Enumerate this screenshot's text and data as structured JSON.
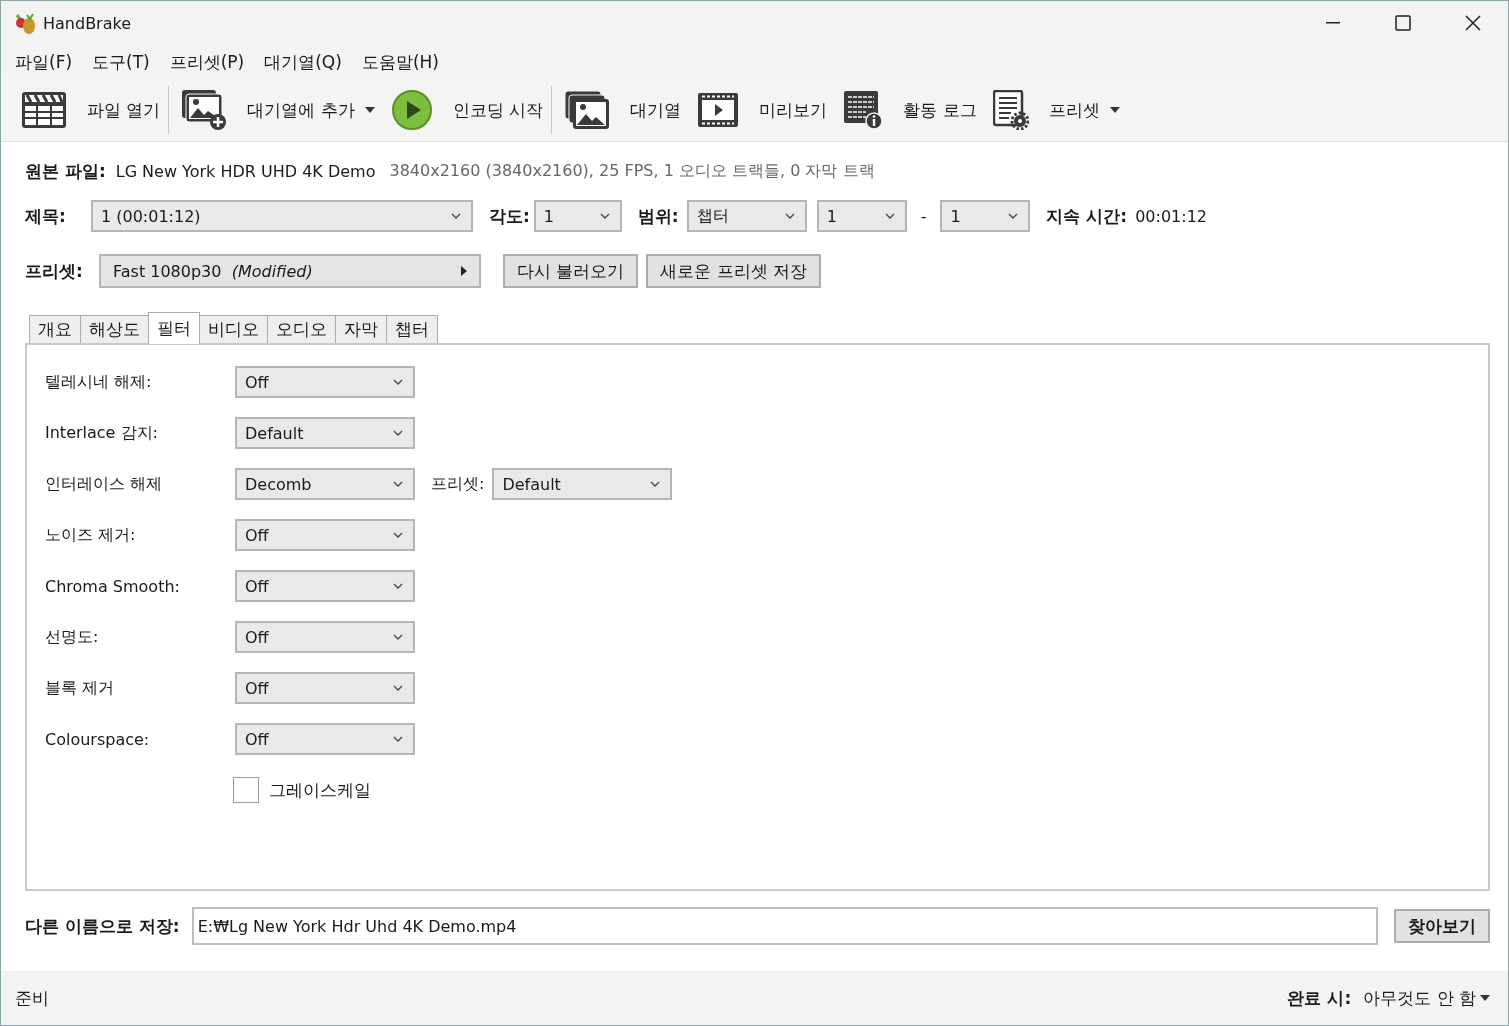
{
  "window": {
    "title": "HandBrake"
  },
  "menu": [
    "파일(F)",
    "도구(T)",
    "프리셋(P)",
    "대기열(Q)",
    "도움말(H)"
  ],
  "toolbar": [
    {
      "kind": "clapper",
      "label": "파일 열기",
      "dropdown": false,
      "separator_after": true
    },
    {
      "kind": "add-image",
      "label": "대기열에 추가",
      "dropdown": true,
      "separator_after": false
    },
    {
      "kind": "play",
      "label": "인코딩 시작",
      "dropdown": false,
      "separator_after": true
    },
    {
      "kind": "images",
      "label": "대기열",
      "dropdown": false,
      "separator_after": false
    },
    {
      "kind": "film",
      "label": "미리보기",
      "dropdown": false,
      "separator_after": false
    },
    {
      "kind": "log",
      "label": "활동 로그",
      "dropdown": false,
      "separator_after": false
    },
    {
      "kind": "preset",
      "label": "프리셋",
      "dropdown": true,
      "separator_after": false
    }
  ],
  "source": {
    "label": "원본 파일:",
    "name": "LG New York HDR UHD 4K Demo",
    "info": "3840x2160 (3840x2160), 25 FPS, 1 오디오 트랙들, 0 자막 트랙"
  },
  "title_select": {
    "label": "제목:",
    "value": "1  (00:01:12)"
  },
  "angle": {
    "label": "각도:",
    "value": "1"
  },
  "range": {
    "label": "범위:",
    "value": "챕터",
    "start": "1",
    "separator": "-",
    "end": "1"
  },
  "duration": {
    "label": "지속 시간:",
    "value": "00:01:12"
  },
  "preset": {
    "label": "프리셋:",
    "name": "Fast 1080p30",
    "modifier": "(Modified)",
    "buttons": [
      "다시 불러오기",
      "새로운 프리셋 저장"
    ]
  },
  "tabs": [
    {
      "label": "개요",
      "selected": false
    },
    {
      "label": "해상도",
      "selected": false
    },
    {
      "label": "필터",
      "selected": true
    },
    {
      "label": "비디오",
      "selected": false
    },
    {
      "label": "오디오",
      "selected": false
    },
    {
      "label": "자막",
      "selected": false
    },
    {
      "label": "챕터",
      "selected": false
    }
  ],
  "filters": [
    {
      "kind": "dropdown",
      "label": "텔레시네 해제:",
      "value": "Off"
    },
    {
      "kind": "dropdown",
      "label": "Interlace 감지:",
      "value": "Default"
    },
    {
      "kind": "dropdown_preset",
      "label": "인터레이스 해제",
      "value": "Decomb",
      "preset_label": "프리셋:",
      "preset_value": "Default"
    },
    {
      "kind": "dropdown",
      "label": "노이즈 제거:",
      "value": "Off"
    },
    {
      "kind": "dropdown",
      "label": "Chroma Smooth:",
      "value": "Off"
    },
    {
      "kind": "dropdown",
      "label": "선명도:",
      "value": "Off"
    },
    {
      "kind": "dropdown",
      "label": "블록 제거",
      "value": "Off"
    },
    {
      "kind": "dropdown",
      "label": "Colourspace:",
      "value": "Off"
    },
    {
      "kind": "checkbox",
      "label": "그레이스케일",
      "checked": false
    }
  ],
  "save_as": {
    "label": "다른 이름으로 저장:",
    "value": "E:₩Lg New York Hdr Uhd 4K Demo.mp4",
    "button": "찾아보기"
  },
  "status_bar": {
    "text": "준비",
    "when_done_label": "완료 시:",
    "when_done_value": "아무것도 안 함"
  }
}
